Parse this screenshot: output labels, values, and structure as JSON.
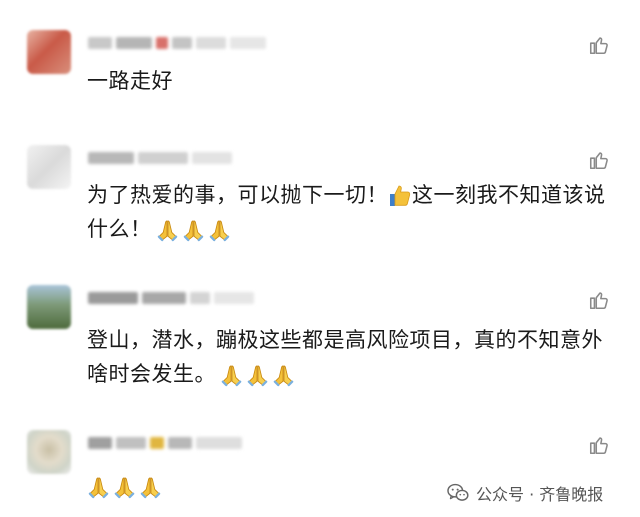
{
  "comments": [
    {
      "text": "一路走好",
      "pray_count": 0
    },
    {
      "text_a": "为了热爱的事，可以抛下一切！",
      "text_b": "这一刻我不知道该说什么！",
      "pray_count": 3
    },
    {
      "text": "登山，潜水，蹦极这些都是高风险项目，真的不知意外啥时会发生。",
      "pray_count": 3
    },
    {
      "text": "",
      "pray_count": 3
    }
  ],
  "watermark": {
    "label": "公众号 · 齐鲁晚报"
  },
  "icons": {
    "like": "thumbs-up-icon",
    "pray": "folded-hands-emoji",
    "thumb": "thumbs-up-emoji",
    "wechat": "wechat-logo-icon"
  },
  "colors": {
    "text": "#1a1a1a",
    "icon_gray": "#8a8a8a",
    "emoji_yellow": "#f4c13a"
  }
}
